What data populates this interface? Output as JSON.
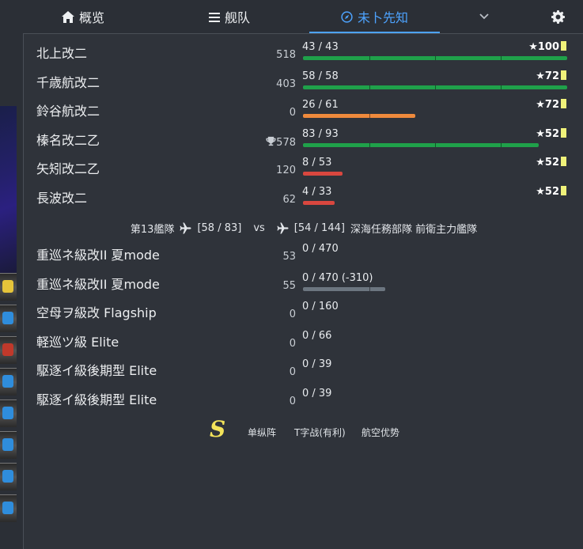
{
  "nav": {
    "tabs": [
      {
        "label": "概览",
        "icon": "home-icon"
      },
      {
        "label": "舰队",
        "icon": "list-icon"
      },
      {
        "label": "未卜先知",
        "icon": "compass-icon"
      }
    ],
    "dropdown_icon": "chevron-down-icon",
    "settings_icon": "gear-icon",
    "active_color": "#4da3ff"
  },
  "allies": [
    {
      "name": "北上改二",
      "level": "518",
      "hp": "43 / 43",
      "hp_fraction": 1.0,
      "cond": "★100",
      "bar_color": "green"
    },
    {
      "name": "千歳航改二",
      "level": "403",
      "hp": "58 / 58",
      "hp_fraction": 1.0,
      "cond": "★72",
      "bar_color": "green"
    },
    {
      "name": "鈴谷航改二",
      "level": "0",
      "hp": "26 / 61",
      "hp_fraction": 0.426,
      "cond": "★72",
      "bar_color": "orange"
    },
    {
      "name": "榛名改二乙",
      "level": "578",
      "level_icon": "trophy-icon",
      "hp": "83 / 93",
      "hp_fraction": 0.892,
      "cond": "★52",
      "bar_color": "green"
    },
    {
      "name": "矢矧改二乙",
      "level": "120",
      "hp": "8 / 53",
      "hp_fraction": 0.151,
      "cond": "★52",
      "bar_color": "red"
    },
    {
      "name": "長波改二",
      "level": "62",
      "hp": "4 / 33",
      "hp_fraction": 0.121,
      "cond": "★52",
      "bar_color": "red"
    }
  ],
  "vs": {
    "ally_fleet": "第13艦隊",
    "ally_air": "[58 / 83]",
    "vs_label": "vs",
    "enemy_air": "[54 / 144]",
    "enemy_fleet": "深海任務部隊 前衛主力艦隊",
    "plane_icon": "airplane-icon"
  },
  "enemies": [
    {
      "name": "重巡ネ級改II 夏mode",
      "level": "53",
      "hp": "0 / 470",
      "hp_fraction": 0
    },
    {
      "name": "重巡ネ級改II 夏mode",
      "level": "55",
      "hp": "0 / 470  (-310)",
      "hp_fraction": 0.34,
      "bar_color": "gray"
    },
    {
      "name": "空母ヲ級改 Flagship",
      "level": "0",
      "hp": "0 / 160",
      "hp_fraction": 0
    },
    {
      "name": "軽巡ツ級 Elite",
      "level": "0",
      "hp": "0 / 66",
      "hp_fraction": 0
    },
    {
      "name": "駆逐イ級後期型 Elite",
      "level": "0",
      "hp": "0 / 39",
      "hp_fraction": 0
    },
    {
      "name": "駆逐イ級後期型 Elite",
      "level": "0",
      "hp": "0 / 39",
      "hp_fraction": 0
    }
  ],
  "summary": {
    "rank": "S",
    "formation": "单纵阵",
    "engagement": "T字战(有利)",
    "air": "航空优势"
  }
}
